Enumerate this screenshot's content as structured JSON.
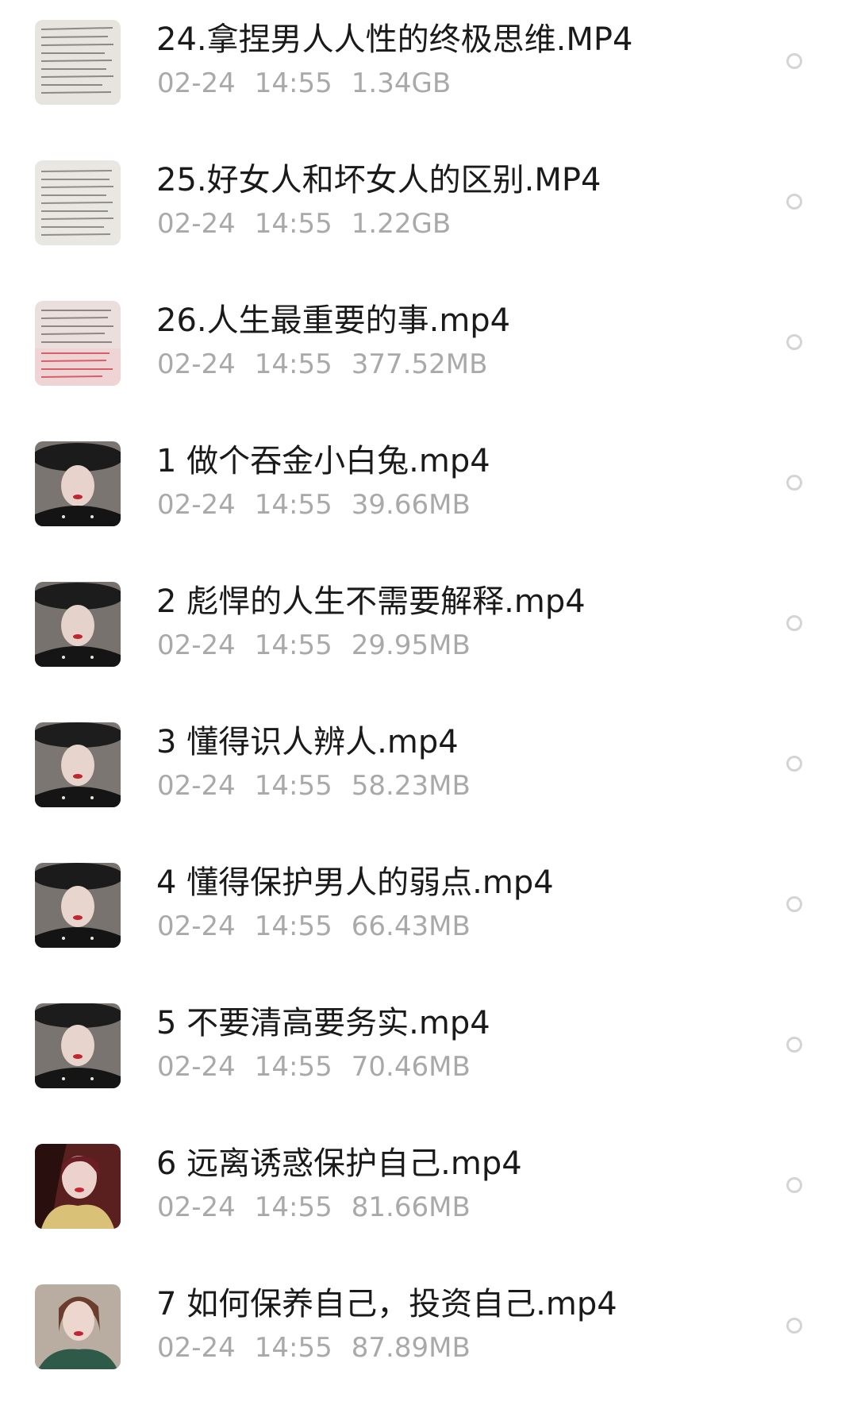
{
  "files": [
    {
      "name": "24.拿捏男人人性的终极思维.MP4",
      "date": "02-24",
      "time": "14:55",
      "size": "1.34GB",
      "thumbnail": "handwritten-notes"
    },
    {
      "name": "25.好女人和坏女人的区别.MP4",
      "date": "02-24",
      "time": "14:55",
      "size": "1.22GB",
      "thumbnail": "handwritten-notes"
    },
    {
      "name": "26.人生最重要的事.mp4",
      "date": "02-24",
      "time": "14:55",
      "size": "377.52MB",
      "thumbnail": "handwritten-notes-pink"
    },
    {
      "name": " 1 做个吞金小白兔.mp4",
      "date": "02-24",
      "time": "14:55",
      "size": "39.66MB",
      "thumbnail": "woman-hat"
    },
    {
      "name": " 2 彪悍的人生不需要解释.mp4",
      "date": "02-24",
      "time": "14:55",
      "size": "29.95MB",
      "thumbnail": "woman-hat"
    },
    {
      "name": " 3 懂得识人辨人.mp4",
      "date": "02-24",
      "time": "14:55",
      "size": "58.23MB",
      "thumbnail": "woman-hat"
    },
    {
      "name": " 4 懂得保护男人的弱点.mp4",
      "date": "02-24",
      "time": "14:55",
      "size": "66.43MB",
      "thumbnail": "woman-hat"
    },
    {
      "name": " 5 不要清高要务实.mp4",
      "date": "02-24",
      "time": "14:55",
      "size": "70.46MB",
      "thumbnail": "woman-hat"
    },
    {
      "name": " 6 远离诱惑保护自己.mp4",
      "date": "02-24",
      "time": "14:55",
      "size": "81.66MB",
      "thumbnail": "woman-yellow-coat"
    },
    {
      "name": " 7 如何保养自己，投资自己.mp4",
      "date": "02-24",
      "time": "14:55",
      "size": "87.89MB",
      "thumbnail": "woman-green-top"
    }
  ]
}
